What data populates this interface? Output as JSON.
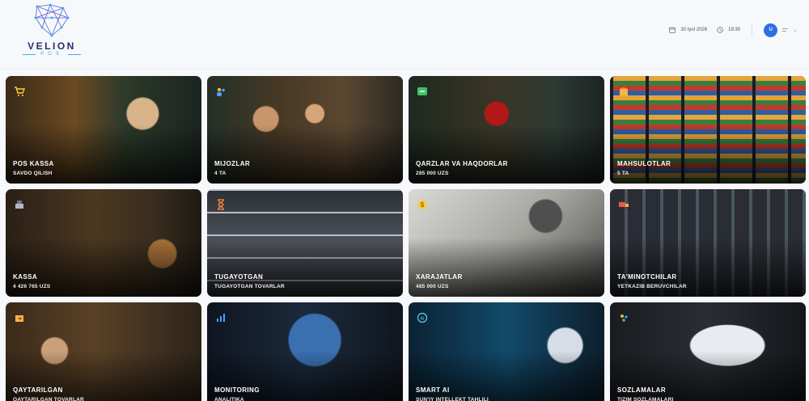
{
  "brand": {
    "name": "VELION",
    "sub": "POS"
  },
  "header": {
    "date": "30 Iyul 2026",
    "time": "19:30",
    "avatar_initial": "U"
  },
  "cards": [
    {
      "title": "POS KASSA",
      "subtitle": "SAVDO QILISH",
      "icon": "cart-icon"
    },
    {
      "title": "MIJOZLAR",
      "subtitle": "4 TA",
      "icon": "users-icon"
    },
    {
      "title": "QARZLAR VA HAQDORLAR",
      "subtitle": "285 000 UZS",
      "icon": "debt-icon"
    },
    {
      "title": "MAHSULOTLAR",
      "subtitle": "5 TA",
      "icon": "box-icon"
    },
    {
      "title": "KASSA",
      "subtitle": "4 426 765 UZS",
      "icon": "register-icon"
    },
    {
      "title": "TUGAYOTGAN",
      "subtitle": "TUGAYOTGAN TOVARLAR",
      "icon": "hourglass-icon"
    },
    {
      "title": "XARAJATLAR",
      "subtitle": "485 000 UZS",
      "icon": "expense-icon"
    },
    {
      "title": "TA'MINOTCHILAR",
      "subtitle": "YETKAZIB BERUVCHILAR",
      "icon": "truck-icon"
    },
    {
      "title": "QAYTARILGAN",
      "subtitle": "QAYTARILGAN TOVARLAR",
      "icon": "return-icon"
    },
    {
      "title": "MONITORING",
      "subtitle": "ANALITIKA",
      "icon": "chart-icon"
    },
    {
      "title": "SMART AI",
      "subtitle": "SUN'IY INTELLEKT TAHLILI",
      "icon": "ai-icon"
    },
    {
      "title": "SOZLAMALAR",
      "subtitle": "TIZIM SOZLAMALARI",
      "icon": "settings-icon"
    }
  ]
}
